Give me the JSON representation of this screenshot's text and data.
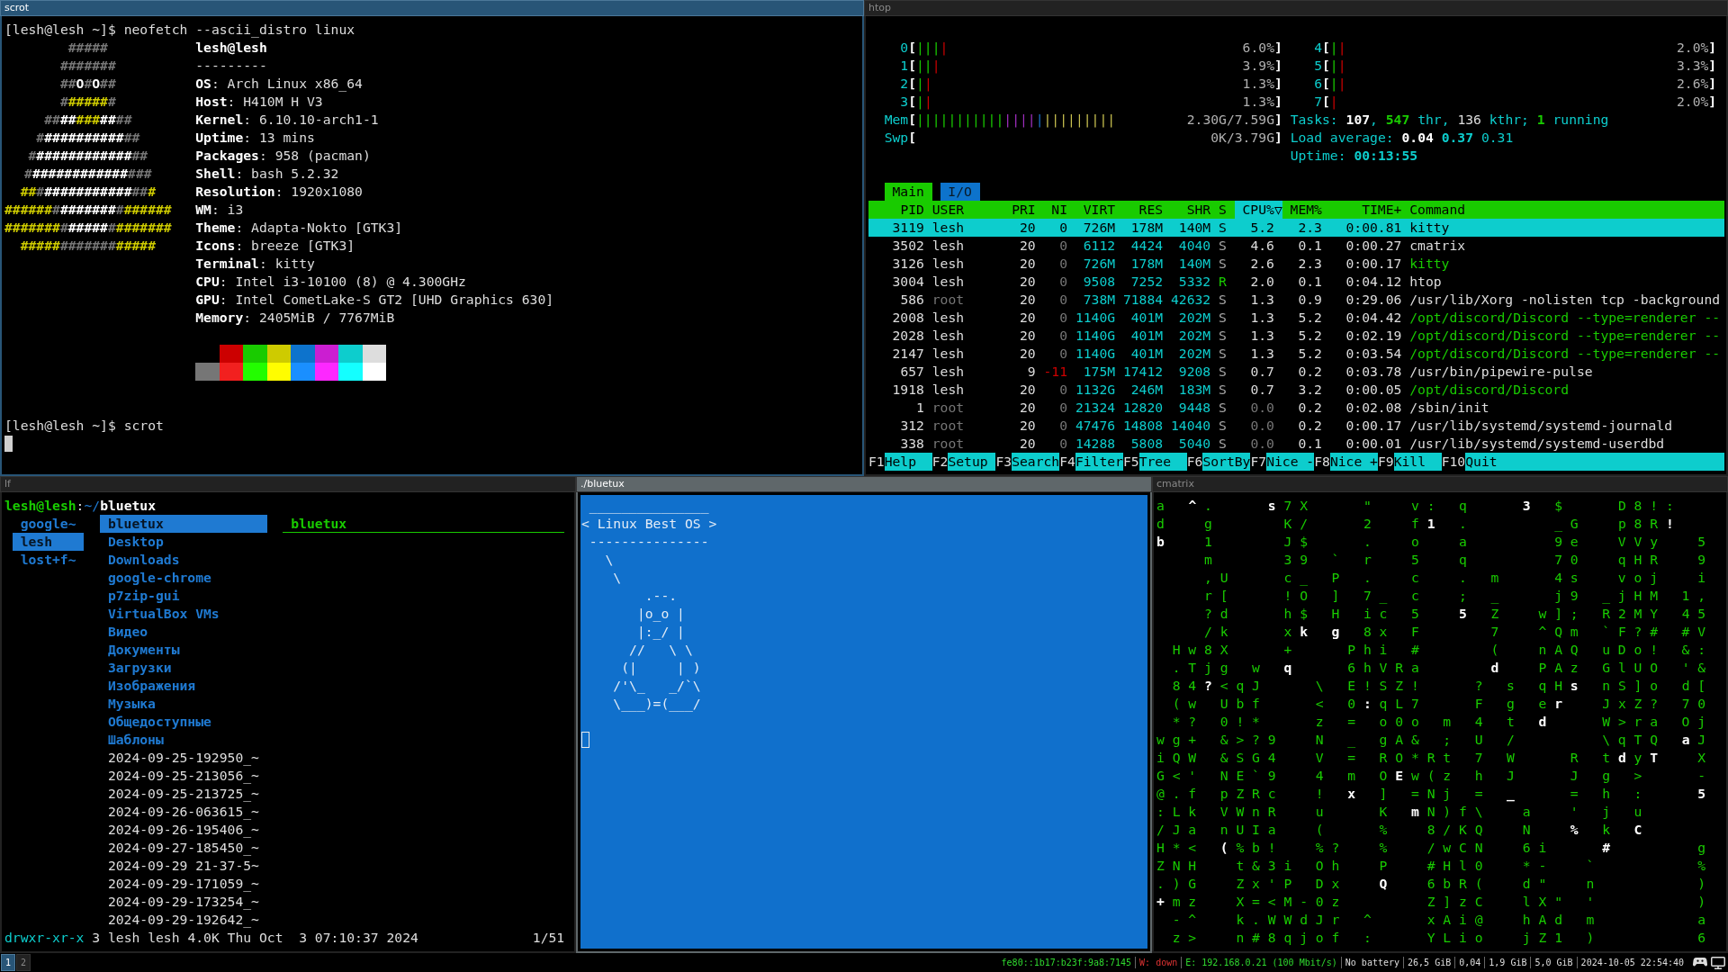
{
  "neofetch_window": {
    "title": "scrot",
    "focused": true,
    "command_line": "[lesh@lesh ~]$ neofetch --ascii_distro linux",
    "logo_lines": [
      {
        "segments": [
          {
            "text": "#####",
            "kind": "dim"
          }
        ]
      },
      {
        "segments": [
          {
            "text": "#######",
            "kind": "dim"
          }
        ]
      },
      {
        "segments": [
          {
            "text": "##",
            "kind": "dim"
          },
          {
            "text": "O",
            "kind": "bright"
          },
          {
            "text": "#",
            "kind": "dim"
          },
          {
            "text": "O",
            "kind": "bright"
          },
          {
            "text": "##",
            "kind": "dim"
          }
        ]
      },
      {
        "segments": [
          {
            "text": "#",
            "kind": "dim"
          },
          {
            "text": "#####",
            "kind": "accent"
          },
          {
            "text": "#",
            "kind": "dim"
          }
        ]
      },
      {
        "segments": [
          {
            "text": "##",
            "kind": "dim"
          },
          {
            "text": "##",
            "kind": "bright"
          },
          {
            "text": "###",
            "kind": "accent"
          },
          {
            "text": "##",
            "kind": "bright"
          },
          {
            "text": "##",
            "kind": "dim"
          }
        ]
      },
      {
        "segments": [
          {
            "text": "#",
            "kind": "dim"
          },
          {
            "text": "##########",
            "kind": "bright"
          },
          {
            "text": "##",
            "kind": "dim"
          }
        ]
      },
      {
        "segments": [
          {
            "text": "#",
            "kind": "dim"
          },
          {
            "text": "############",
            "kind": "bright"
          },
          {
            "text": "##",
            "kind": "dim"
          }
        ]
      },
      {
        "segments": [
          {
            "text": "#",
            "kind": "dim"
          },
          {
            "text": "############",
            "kind": "bright"
          },
          {
            "text": "###",
            "kind": "dim"
          }
        ]
      },
      {
        "segments": [
          {
            "text": "##",
            "kind": "accent"
          },
          {
            "text": "#",
            "kind": "dim"
          },
          {
            "text": "###########",
            "kind": "bright"
          },
          {
            "text": "##",
            "kind": "dim"
          },
          {
            "text": "#",
            "kind": "accent"
          }
        ]
      },
      {
        "segments": [
          {
            "text": "######",
            "kind": "accent"
          },
          {
            "text": "#",
            "kind": "dim"
          },
          {
            "text": "#######",
            "kind": "bright"
          },
          {
            "text": "#",
            "kind": "dim"
          },
          {
            "text": "######",
            "kind": "accent"
          }
        ]
      },
      {
        "segments": [
          {
            "text": "#######",
            "kind": "accent"
          },
          {
            "text": "#",
            "kind": "dim"
          },
          {
            "text": "#####",
            "kind": "bright"
          },
          {
            "text": "#",
            "kind": "dim"
          },
          {
            "text": "#######",
            "kind": "accent"
          }
        ]
      },
      {
        "segments": [
          {
            "text": "#####",
            "kind": "accent"
          },
          {
            "text": "#######",
            "kind": "dim"
          },
          {
            "text": "#####",
            "kind": "accent"
          }
        ]
      }
    ],
    "user_host": "lesh@lesh",
    "rule": "---------",
    "info_lines": [
      "**OS**: Arch Linux x86_64",
      "**Host**: H410M H V3",
      "**Kernel**: 6.10.10-arch1-1",
      "**Uptime**: 13 mins",
      "**Packages**: 958 (pacman)",
      "**Shell**: bash 5.2.32",
      "**Resolution**: 1920x1080",
      "**WM**: i3",
      "**Theme**: Adapta-Nokto [GTK3]",
      "**Icons**: breeze [GTK3]",
      "**Terminal**: kitty",
      "**CPU**: Intel i3-10100 (8) @ 4.300GHz",
      "**GPU**: Intel CometLake-S GT2 [UHD Graphics 630]",
      "**Memory**: 2405MiB / 7767MiB"
    ],
    "palette_rows": [
      {
        "swatches": [
          {
            "color": "#cc0000"
          },
          {
            "color": "#19cb00"
          },
          {
            "color": "#cecb00"
          },
          {
            "color": "#0d73cc"
          },
          {
            "color": "#cb1ed1"
          },
          {
            "color": "#0dcdcd"
          },
          {
            "color": "#dddddd"
          }
        ]
      },
      {
        "swatches": [
          {
            "color": "#767676"
          },
          {
            "color": "#f2201f"
          },
          {
            "color": "#23fd00"
          },
          {
            "color": "#fffd00"
          },
          {
            "color": "#1a8fff"
          },
          {
            "color": "#fd28ff"
          },
          {
            "color": "#14ffff"
          },
          {
            "color": "#ffffff"
          }
        ]
      }
    ],
    "prompt_line": "[lesh@lesh ~]$ scrot",
    "cursor": true
  },
  "htop_window": {
    "title": "htop",
    "focused": false,
    "inactive_focus": false,
    "left_column": {
      "cpu_meters": [
        {
          "label": "0**[**",
          "bars": [
            {
              "text": "|||",
              "kind": "user"
            },
            {
              "text": "|",
              "kind": "kernel"
            }
          ],
          "reading": "6.0%**]**"
        },
        {
          "label": "1**[**",
          "bars": [
            {
              "text": "||",
              "kind": "user"
            },
            {
              "text": "|",
              "kind": "kernel"
            }
          ],
          "reading": "3.9%**]**"
        },
        {
          "label": "2**[**",
          "bars": [
            {
              "text": "|",
              "kind": "user"
            },
            {
              "text": "|",
              "kind": "kernel"
            }
          ],
          "reading": "1.3%**]**"
        },
        {
          "label": "3**[**",
          "bars": [
            {
              "text": "|",
              "kind": "user"
            },
            {
              "text": "|",
              "kind": "kernel"
            }
          ],
          "reading": "1.3%**]**"
        }
      ],
      "memory_meters": [
        {
          "label": "Mem**[**",
          "bars": [
            {
              "text": "|||||||||||",
              "kind": "used"
            },
            {
              "text": "||||",
              "kind": "shared"
            },
            {
              "text": "|",
              "kind": "buffers"
            },
            {
              "text": "|||||||||",
              "kind": "cache"
            }
          ],
          "reading": "2.30G/7.59G**]**"
        },
        {
          "label": "Swp**[**",
          "reading": "0K/3.79G**]**"
        }
      ]
    },
    "right_column": {
      "cpu_meters": [
        {
          "label": "4**[**",
          "bars": [
            {
              "text": "|",
              "kind": "user"
            },
            {
              "text": "|",
              "kind": "kernel"
            }
          ],
          "reading": "2.0%**]**"
        },
        {
          "label": "5**[**",
          "bars": [
            {
              "text": "|",
              "kind": "user"
            },
            {
              "text": "|",
              "kind": "kernel"
            }
          ],
          "reading": "3.3%**]**"
        },
        {
          "label": "6**[**",
          "bars": [
            {
              "text": "|",
              "kind": "user"
            },
            {
              "text": "|",
              "kind": "kernel"
            }
          ],
          "reading": "2.6%**]**"
        },
        {
          "label": "7**[**",
          "bars": [
            {
              "text": "|",
              "kind": "kernel"
            }
          ],
          "reading": "2.0%**]**"
        }
      ],
      "tasks": [
        {
          "text": "Tasks: ",
          "kind": "label"
        },
        {
          "text": "107",
          "kind": "value"
        },
        {
          "text": ", ",
          "kind": "label"
        },
        {
          "text": "547",
          "kind": "good"
        },
        {
          "text": " thr, ",
          "kind": "label"
        },
        {
          "text": "136",
          "kind": "plain"
        },
        {
          "text": " kthr; ",
          "kind": "label"
        },
        {
          "text": "1",
          "kind": "good"
        },
        {
          "text": " running",
          "kind": "label"
        }
      ],
      "load_average": [
        {
          "text": "Load average: ",
          "kind": "label"
        },
        {
          "text": "0.04 ",
          "kind": "value"
        },
        {
          "text": "0.37 ",
          "kind": "accent"
        },
        {
          "text": "0.31",
          "kind": "label"
        }
      ],
      "uptime": [
        {
          "text": "Uptime: ",
          "kind": "label"
        },
        {
          "text": "00:13:55",
          "kind": "accent"
        }
      ]
    },
    "tabs": [
      {
        "label": "Main",
        "selected": true
      },
      {
        "label": "I/O",
        "selected": false
      }
    ],
    "columns": [
      {
        "label": "PID",
        "sorted": false
      },
      {
        "label": "USER",
        "sorted": false
      },
      {
        "label": "PRI",
        "sorted": false
      },
      {
        "label": "NI",
        "sorted": false
      },
      {
        "label": "VIRT",
        "sorted": false
      },
      {
        "label": "RES",
        "sorted": false
      },
      {
        "label": "SHR",
        "sorted": false
      },
      {
        "label": "S",
        "sorted": false
      },
      {
        "label": "CPU%▽",
        "sorted": true
      },
      {
        "label": "MEM%",
        "sorted": false
      },
      {
        "label": "TIME+",
        "sorted": false
      },
      {
        "label": "Command",
        "sorted": false
      }
    ],
    "processes": [
      {
        "cells": [
          "3119",
          "lesh",
          "20",
          "0",
          "726M",
          "178M",
          "140M",
          "S",
          "5.2",
          "2.3",
          "0:00.81",
          "kitty"
        ],
        "selected": true,
        "other_user": false,
        "thread": false,
        "running": false,
        "niced": false,
        "idle": false
      },
      {
        "cells": [
          "3502",
          "lesh",
          "20",
          "0",
          "6112",
          "4424",
          "4040",
          "S",
          "4.6",
          "0.1",
          "0:00.27",
          "cmatrix"
        ],
        "selected": false,
        "other_user": false,
        "thread": false,
        "running": false,
        "niced": false,
        "idle": false
      },
      {
        "cells": [
          "3126",
          "lesh",
          "20",
          "0",
          "726M",
          "178M",
          "140M",
          "S",
          "2.6",
          "2.3",
          "0:00.17",
          "kitty"
        ],
        "selected": false,
        "other_user": false,
        "thread": true,
        "running": false,
        "niced": false,
        "idle": false
      },
      {
        "cells": [
          "3004",
          "lesh",
          "20",
          "0",
          "9508",
          "7252",
          "5332",
          "R",
          "2.0",
          "0.1",
          "0:04.12",
          "htop"
        ],
        "selected": false,
        "other_user": false,
        "thread": false,
        "running": true,
        "niced": false,
        "idle": false
      },
      {
        "cells": [
          "586",
          "root",
          "20",
          "0",
          "738M",
          "71884",
          "42632",
          "S",
          "1.3",
          "0.9",
          "0:29.06",
          "/usr/lib/Xorg -nolisten tcp -background"
        ],
        "selected": false,
        "other_user": true,
        "thread": false,
        "running": false,
        "niced": false,
        "idle": false
      },
      {
        "cells": [
          "2008",
          "lesh",
          "20",
          "0",
          "1140G",
          "401M",
          "202M",
          "S",
          "1.3",
          "5.2",
          "0:04.42",
          "/opt/discord/Discord --type=renderer --"
        ],
        "selected": false,
        "other_user": false,
        "thread": true,
        "running": false,
        "niced": false,
        "idle": false
      },
      {
        "cells": [
          "2028",
          "lesh",
          "20",
          "0",
          "1140G",
          "401M",
          "202M",
          "S",
          "1.3",
          "5.2",
          "0:02.19",
          "/opt/discord/Discord --type=renderer --"
        ],
        "selected": false,
        "other_user": false,
        "thread": true,
        "running": false,
        "niced": false,
        "idle": false
      },
      {
        "cells": [
          "2147",
          "lesh",
          "20",
          "0",
          "1140G",
          "401M",
          "202M",
          "S",
          "1.3",
          "5.2",
          "0:03.54",
          "/opt/discord/Discord --type=renderer --"
        ],
        "selected": false,
        "other_user": false,
        "thread": true,
        "running": false,
        "niced": false,
        "idle": false
      },
      {
        "cells": [
          "657",
          "lesh",
          "9",
          "-11",
          "175M",
          "17412",
          "9208",
          "S",
          "0.7",
          "0.2",
          "0:03.78",
          "/usr/bin/pipewire-pulse"
        ],
        "selected": false,
        "other_user": false,
        "thread": false,
        "running": false,
        "niced": true,
        "idle": false
      },
      {
        "cells": [
          "1918",
          "lesh",
          "20",
          "0",
          "1132G",
          "246M",
          "183M",
          "S",
          "0.7",
          "3.2",
          "0:00.05",
          "/opt/discord/Discord"
        ],
        "selected": false,
        "other_user": false,
        "thread": true,
        "running": false,
        "niced": false,
        "idle": false
      },
      {
        "cells": [
          "1",
          "root",
          "20",
          "0",
          "21324",
          "12820",
          "9448",
          "S",
          "0.0",
          "0.2",
          "0:02.08",
          "/sbin/init"
        ],
        "selected": false,
        "other_user": true,
        "thread": false,
        "running": false,
        "niced": false,
        "idle": true
      },
      {
        "cells": [
          "312",
          "root",
          "20",
          "0",
          "47476",
          "14808",
          "14040",
          "S",
          "0.0",
          "0.2",
          "0:00.17",
          "/usr/lib/systemd/systemd-journald"
        ],
        "selected": false,
        "other_user": true,
        "thread": false,
        "running": false,
        "niced": false,
        "idle": true
      },
      {
        "cells": [
          "338",
          "root",
          "20",
          "0",
          "14288",
          "5808",
          "5040",
          "S",
          "0.0",
          "0.1",
          "0:00.01",
          "/usr/lib/systemd/systemd-userdbd"
        ],
        "selected": false,
        "other_user": true,
        "thread": false,
        "running": false,
        "niced": false,
        "idle": true
      }
    ],
    "function_keys": [
      {
        "key": "F1",
        "label": "Help"
      },
      {
        "key": "F2",
        "label": "Setup"
      },
      {
        "key": "F3",
        "label": "Search"
      },
      {
        "key": "F4",
        "label": "Filter"
      },
      {
        "key": "F5",
        "label": "Tree"
      },
      {
        "key": "F6",
        "label": "SortBy"
      },
      {
        "key": "F7",
        "label": "Nice -"
      },
      {
        "key": "F8",
        "label": "Nice +"
      },
      {
        "key": "F9",
        "label": "Kill"
      },
      {
        "key": "F10",
        "label": "Quit"
      }
    ]
  },
  "file_manager_window": {
    "title": "lf",
    "focused": false,
    "inactive_focus": false,
    "path_line": [
      {
        "text": "lesh@lesh",
        "kind": "user"
      },
      {
        "text": ":",
        "kind": "plain"
      },
      {
        "text": "~/",
        "kind": "dir"
      },
      {
        "text": "bluetux",
        "kind": "name"
      }
    ],
    "parent_entries": [
      {
        "name": "google~",
        "selected": false
      },
      {
        "name": "lesh",
        "selected": true
      },
      {
        "name": "lost+f~",
        "selected": false
      }
    ],
    "entries": [
      {
        "name": "bluetux",
        "kind": "dir",
        "selected": true
      },
      {
        "name": "Desktop",
        "kind": "dir",
        "selected": false
      },
      {
        "name": "Downloads",
        "kind": "dir",
        "selected": false
      },
      {
        "name": "google-chrome",
        "kind": "dir",
        "selected": false
      },
      {
        "name": "p7zip-gui",
        "kind": "dir",
        "selected": false
      },
      {
        "name": "VirtualBox VMs",
        "kind": "dir",
        "selected": false
      },
      {
        "name": "Видео",
        "kind": "dir",
        "selected": false
      },
      {
        "name": "Документы",
        "kind": "dir",
        "selected": false
      },
      {
        "name": "Загрузки",
        "kind": "dir",
        "selected": false
      },
      {
        "name": "Изображения",
        "kind": "dir",
        "selected": false
      },
      {
        "name": "Музыка",
        "kind": "dir",
        "selected": false
      },
      {
        "name": "Общедоступные",
        "kind": "dir",
        "selected": false
      },
      {
        "name": "Шаблоны",
        "kind": "dir",
        "selected": false
      },
      {
        "name": "2024-09-25-192950_~",
        "kind": "file",
        "selected": false
      },
      {
        "name": "2024-09-25-213056_~",
        "kind": "file",
        "selected": false
      },
      {
        "name": "2024-09-25-213725_~",
        "kind": "file",
        "selected": false
      },
      {
        "name": "2024-09-26-063615_~",
        "kind": "file",
        "selected": false
      },
      {
        "name": "2024-09-26-195406_~",
        "kind": "file",
        "selected": false
      },
      {
        "name": "2024-09-27-185450_~",
        "kind": "file",
        "selected": false
      },
      {
        "name": "2024-09-29 21-37-5~",
        "kind": "file",
        "selected": false
      },
      {
        "name": "2024-09-29-171059_~",
        "kind": "file",
        "selected": false
      },
      {
        "name": "2024-09-29-173254_~",
        "kind": "file",
        "selected": false
      },
      {
        "name": "2024-09-29-192642_~",
        "kind": "file",
        "selected": false
      }
    ],
    "preview_title": "bluetux",
    "info_line": [
      {
        "text": "drwxr-xr-x",
        "kind": "mode"
      },
      {
        "text": " 3 lesh lesh 4.0K Thu Oct  3 07:10:37 2024",
        "kind": "plain"
      }
    ],
    "position": "1/51"
  },
  "cowsay_window": {
    "title": "./bluetux",
    "focused": false,
    "inactive_focus": true,
    "bubble_lines": [
      " _______________",
      "< Linux Best OS >",
      " ---------------"
    ],
    "tux_lines": [
      "\\",
      " \\",
      "     .--.",
      "    |o_o |",
      "    |:_/ |",
      "   //   \\ \\",
      "  (|     | )",
      " /'\\_   _/`\\",
      " \\___)=(___/"
    ],
    "cursor": true
  },
  "matrix_window": {
    "title": "cmatrix",
    "focused": false,
    "inactive_focus": false,
    "rows": [
      {
        "segments": [
          {
            "text": "a   ",
            "kind": "trail"
          },
          {
            "text": "^",
            "kind": "head"
          },
          {
            "text": " .       ",
            "kind": "trail"
          },
          {
            "text": "s",
            "kind": "head"
          },
          {
            "text": " 7 X       \"     v :   q       ",
            "kind": "trail"
          },
          {
            "text": "3",
            "kind": "head"
          },
          {
            "text": "   $       D 8 ! :",
            "kind": "trail"
          }
        ]
      },
      {
        "segments": [
          {
            "text": "d     g         K /       2     f ",
            "kind": "trail"
          },
          {
            "text": "1",
            "kind": "head"
          },
          {
            "text": "   .           _ G     p 8 R ",
            "kind": "trail"
          },
          {
            "text": "!",
            "kind": "head"
          }
        ]
      },
      {
        "segments": [
          {
            "text": "b",
            "kind": "head"
          },
          {
            "text": "     1         J $       .     o     a           9 e     V V y     5",
            "kind": "trail"
          }
        ]
      },
      {
        "segments": [
          {
            "text": "      m         3 9   `   r     5     q           7 0     q H R     9",
            "kind": "trail"
          }
        ]
      },
      {
        "segments": [
          {
            "text": "      , U       c _   P   .     c     .   m       4 s     v o j     i",
            "kind": "trail"
          }
        ]
      },
      {
        "segments": [
          {
            "text": "      r [       ! O   ]   7 _   c     ;   _       j 9   _ j H M   1 ,",
            "kind": "trail"
          }
        ]
      },
      {
        "segments": [
          {
            "text": "      ? d       h $   H   i c   5     ",
            "kind": "trail"
          },
          {
            "text": "5",
            "kind": "head"
          },
          {
            "text": "   Z     w ] ;   R 2 M Y   4 5",
            "kind": "trail"
          }
        ]
      },
      {
        "segments": [
          {
            "text": "      / k       x ",
            "kind": "trail"
          },
          {
            "text": "k   ",
            "kind": "head"
          },
          {
            "text": "g",
            "kind": "head"
          },
          {
            "text": "   8 x   F         7     ^ Q m   ` F ? #   # V",
            "kind": "trail"
          }
        ]
      },
      {
        "segments": [
          {
            "text": "  H w 8 X       +       P h i   #         (     n A Q   u D o !   & :",
            "kind": "trail"
          }
        ]
      },
      {
        "segments": [
          {
            "text": "  . T j g   w   ",
            "kind": "trail"
          },
          {
            "text": "q",
            "kind": "head"
          },
          {
            "text": "       6 h V R a         ",
            "kind": "trail"
          },
          {
            "text": "d",
            "kind": "head"
          },
          {
            "text": "     P A z   G l U O   ' &",
            "kind": "trail"
          }
        ]
      },
      {
        "segments": [
          {
            "text": "  8 4 ",
            "kind": "trail"
          },
          {
            "text": "?",
            "kind": "head"
          },
          {
            "text": " < q J       \\   E ! S Z !       ?   s   q H ",
            "kind": "trail"
          },
          {
            "text": "s",
            "kind": "head"
          },
          {
            "text": "   n S ] o   d [",
            "kind": "trail"
          }
        ]
      },
      {
        "segments": [
          {
            "text": "  ( w   U b f       <   0 ",
            "kind": "trail"
          },
          {
            "text": ":",
            "kind": "head"
          },
          {
            "text": " q L 7       F   g   e ",
            "kind": "trail"
          },
          {
            "text": "r",
            "kind": "head"
          },
          {
            "text": "     J x Z ?   7 0",
            "kind": "trail"
          }
        ]
      },
      {
        "segments": [
          {
            "text": "  * ?   0 ! *       z   =   o 0 o   m   4   t   ",
            "kind": "trail"
          },
          {
            "text": "d",
            "kind": "head"
          },
          {
            "text": "       W > r a   O j",
            "kind": "trail"
          }
        ]
      },
      {
        "segments": [
          {
            "text": "w g +   & > ? 9     N   _   g A &   ;   U   /           \\ q T Q   ",
            "kind": "trail"
          },
          {
            "text": "a",
            "kind": "head"
          },
          {
            "text": " J",
            "kind": "trail"
          }
        ]
      },
      {
        "segments": [
          {
            "text": "i Q W   & S G 4     V   =   R O * R t   7   W       R   t ",
            "kind": "trail"
          },
          {
            "text": "d",
            "kind": "head"
          },
          {
            "text": " y ",
            "kind": "trail"
          },
          {
            "text": "T",
            "kind": "head"
          },
          {
            "text": "     X",
            "kind": "trail"
          }
        ]
      },
      {
        "segments": [
          {
            "text": "G < '   N E ` 9     4   m   O ",
            "kind": "trail"
          },
          {
            "text": "E",
            "kind": "head"
          },
          {
            "text": " w ( z   h   J       J   g   >       -",
            "kind": "trail"
          }
        ]
      },
      {
        "segments": [
          {
            "text": "@ . f   p Z R c     !   ",
            "kind": "trail"
          },
          {
            "text": "x",
            "kind": "head"
          },
          {
            "text": "   ]   = N j   =   ",
            "kind": "trail"
          },
          {
            "text": "_",
            "kind": "head"
          },
          {
            "text": "       =   h   :       ",
            "kind": "trail"
          },
          {
            "text": "5",
            "kind": "head"
          }
        ]
      },
      {
        "segments": [
          {
            "text": ": L k   V W n R     u       K   ",
            "kind": "trail"
          },
          {
            "text": "m",
            "kind": "head"
          },
          {
            "text": " N ) f \\     a     '   j   u",
            "kind": "trail"
          }
        ]
      },
      {
        "segments": [
          {
            "text": "/ J a   n U I a     (       %     8 / K Q     N     ",
            "kind": "trail"
          },
          {
            "text": "%",
            "kind": "head"
          },
          {
            "text": "   k   ",
            "kind": "trail"
          },
          {
            "text": "C",
            "kind": "head"
          }
        ]
      },
      {
        "segments": [
          {
            "text": "H * <   ",
            "kind": "trail"
          },
          {
            "text": "(",
            "kind": "head"
          },
          {
            "text": " % b !     % ?     %     / w C N     6 i       ",
            "kind": "trail"
          },
          {
            "text": "#",
            "kind": "head"
          },
          {
            "text": "           g",
            "kind": "trail"
          }
        ]
      },
      {
        "segments": [
          {
            "text": "Z N H     t & 3 i   O h     P     # H l 0     * -     `             %",
            "kind": "trail"
          }
        ]
      },
      {
        "segments": [
          {
            "text": ". ) G     Z x ' P   D x     ",
            "kind": "trail"
          },
          {
            "text": "Q",
            "kind": "head"
          },
          {
            "text": "     6 b R (     d \"     n             )",
            "kind": "trail"
          }
        ]
      },
      {
        "segments": [
          {
            "text": "+",
            "kind": "head"
          },
          {
            "text": " m z     X = < M - 0 z           Z ] z C     l X \"   '             )",
            "kind": "trail"
          }
        ]
      },
      {
        "segments": [
          {
            "text": "  - ^     k . W W d J r   ^       x A i @     h A d   m             a",
            "kind": "trail"
          }
        ]
      },
      {
        "segments": [
          {
            "text": "  z >     n # 8 q j o f   :       Y L i o     j Z 1   )             6",
            "kind": "trail"
          }
        ]
      }
    ]
  },
  "status_bar": {
    "workspaces": [
      {
        "label": "1",
        "selected": true
      },
      {
        "label": "2",
        "selected": false
      }
    ],
    "blocks": [
      {
        "text": "fe80::1b17:b23f:9a8:7145",
        "color": "#2fd82f"
      },
      {
        "text": "W: down",
        "color": "#e03333"
      },
      {
        "text": "E: 192.168.0.21 (100 Mbit/s)",
        "color": "#2fd82f"
      },
      {
        "text": "No battery",
        "color": "#dddddd"
      },
      {
        "text": "26,5 GiB",
        "color": "#dddddd"
      },
      {
        "text": "0,04",
        "color": "#dddddd"
      },
      {
        "text": "1,9 GiB",
        "color": "#dddddd"
      },
      {
        "text": "5,0 GiB",
        "color": "#dddddd"
      },
      {
        "text": "2024-10-05 22:54:40",
        "color": "#dddddd"
      }
    ]
  }
}
